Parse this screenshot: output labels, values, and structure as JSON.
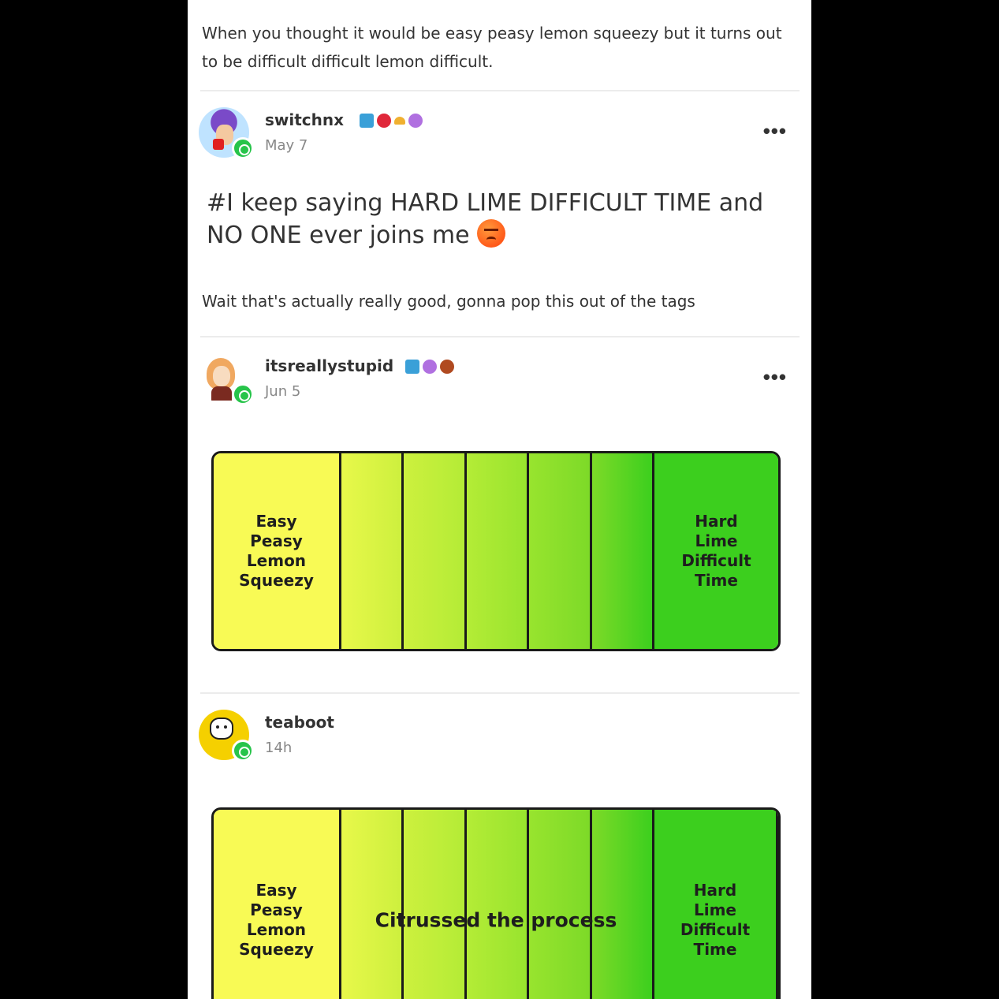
{
  "intro": {
    "text": "When you thought it would be easy peasy lemon squeezy but it turns out to be difficult difficult lemon difficult."
  },
  "posts": [
    {
      "username": "switchnx",
      "date": "May 7",
      "body": "#I keep saying HARD LIME DIFFICULT TIME and NO ONE ever joins me",
      "emoji": "angry-face-icon"
    },
    {
      "reblog_comment": "Wait that's actually really good, gonna pop this out of the tags"
    },
    {
      "username": "itsreallystupid",
      "date": "Jun 5"
    },
    {
      "username": "teaboot",
      "date": "14h"
    }
  ],
  "scale": {
    "left_label": "Easy\nPeasy\nLemon\nSqueezy",
    "right_label": "Hard\nLime\nDifficult\nTime",
    "caption": "Citrussed the process",
    "colors": [
      "#f8fa55",
      "#e8f84a",
      "#cdf03e",
      "#b4ec36",
      "#98e42e",
      "#7dda28",
      "#3ccf1e"
    ]
  },
  "more_menu_label": "•••"
}
